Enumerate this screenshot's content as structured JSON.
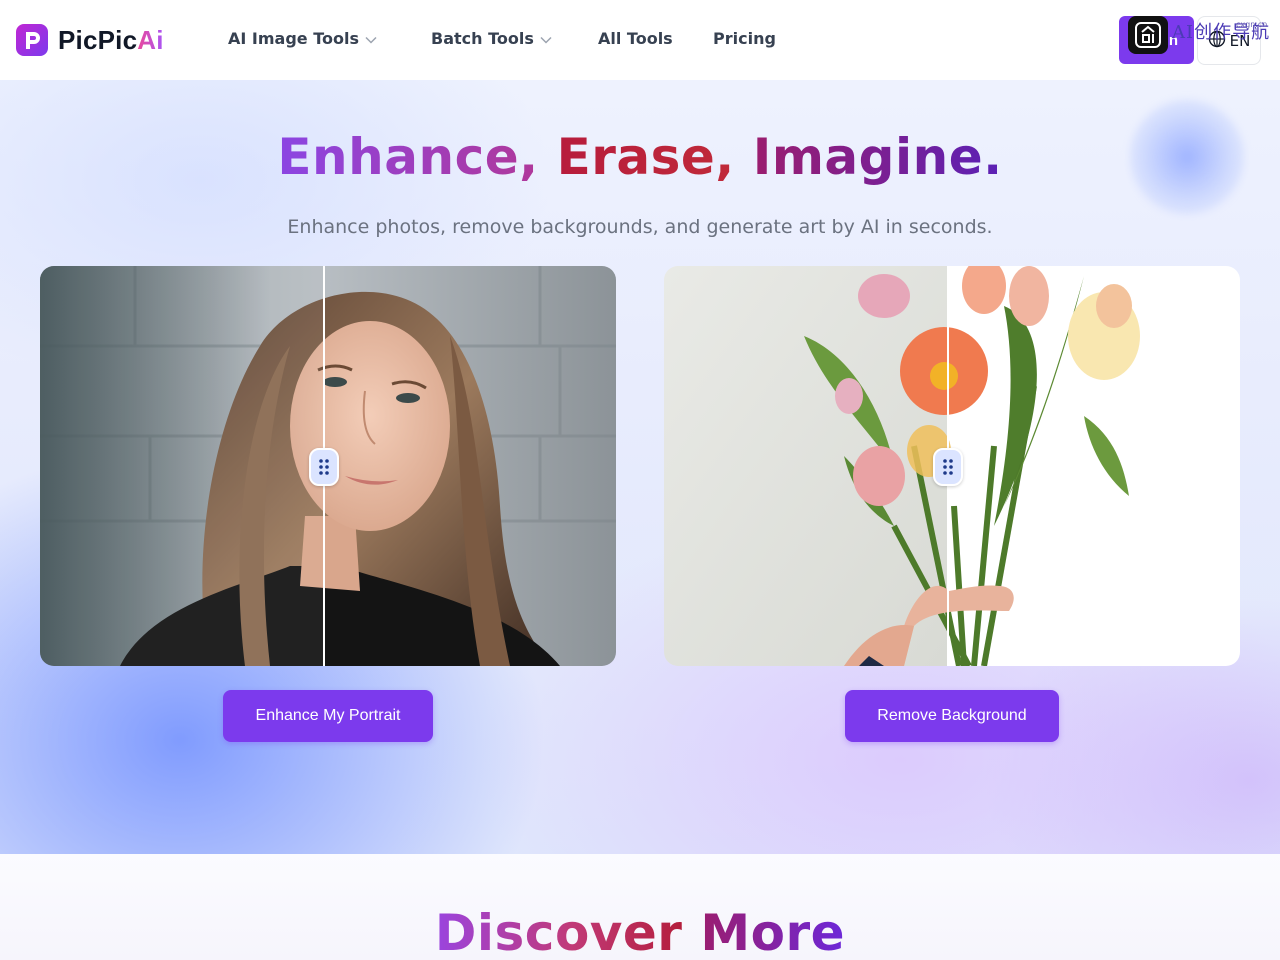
{
  "brand": {
    "name_main": "PicPic",
    "name_accent": "Ai",
    "logo_icon": "p-logo-icon"
  },
  "nav": {
    "items": [
      {
        "label": "AI Image Tools",
        "has_dropdown": true
      },
      {
        "label": "Batch Tools",
        "has_dropdown": true
      },
      {
        "label": "All Tools",
        "has_dropdown": false
      },
      {
        "label": "Pricing",
        "has_dropdown": false
      }
    ],
    "login_label_visible": "n",
    "language": "EN",
    "language_icon": "globe-icon"
  },
  "watermark": {
    "text": "AI创作导航",
    "domain": "cxgn.cn",
    "icon": "chuang-logo-icon"
  },
  "hero": {
    "title_parts": [
      "Enhance,",
      "Erase,",
      "Imagine."
    ],
    "subtitle": "Enhance photos, remove backgrounds, and generate art by AI in seconds.",
    "cards": [
      {
        "name": "portrait-enhance-comparison",
        "split_position": 0.49,
        "cta": "Enhance My Portrait"
      },
      {
        "name": "background-remove-comparison",
        "split_position": 0.49,
        "cta": "Remove Background"
      }
    ]
  },
  "discover": {
    "title_parts": [
      "Discover",
      "More"
    ]
  },
  "colors": {
    "accent": "#7c3aed",
    "nav_text": "#374151",
    "subtitle": "#6b7280",
    "title_purple": "#8b45e3",
    "title_red": "#b71c3c",
    "title_magenta": "#9b1d6e"
  }
}
